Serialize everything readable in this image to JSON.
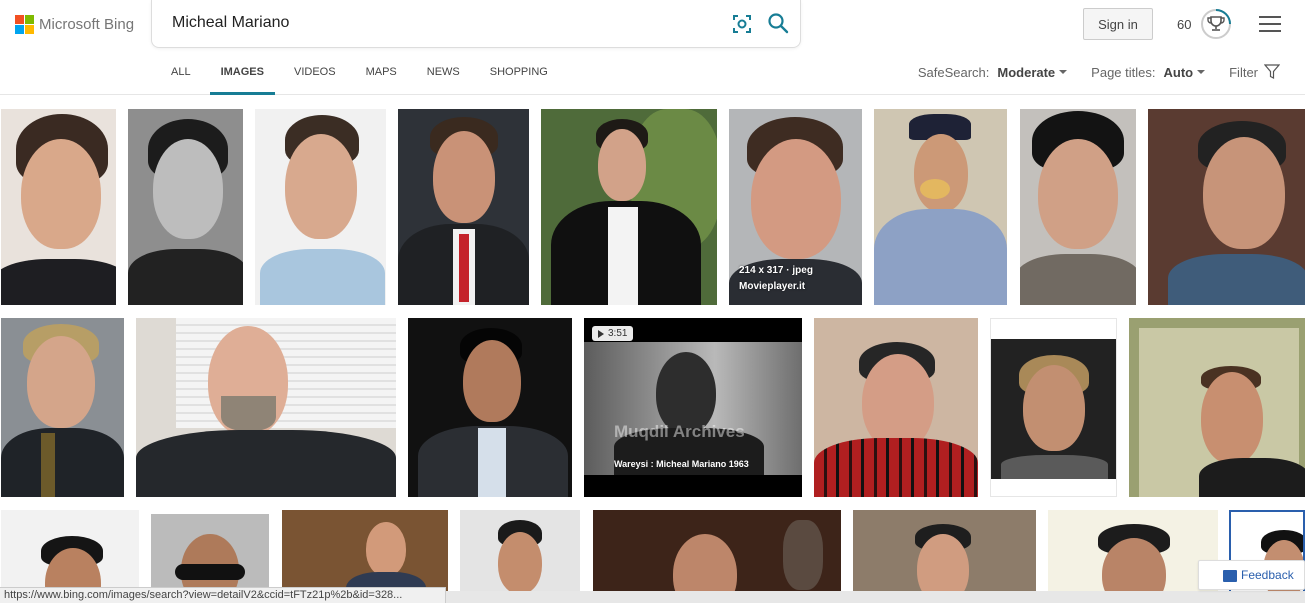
{
  "brand": {
    "name": "Microsoft Bing",
    "logo_colors": [
      "#f25022",
      "#7fba00",
      "#00a4ef",
      "#ffb900"
    ]
  },
  "search": {
    "query": "Micheal Mariano"
  },
  "account": {
    "signin_label": "Sign in",
    "rewards_points": "60"
  },
  "tabs": [
    {
      "label": "ALL",
      "active": false
    },
    {
      "label": "IMAGES",
      "active": true
    },
    {
      "label": "VIDEOS",
      "active": false
    },
    {
      "label": "MAPS",
      "active": false
    },
    {
      "label": "NEWS",
      "active": false
    },
    {
      "label": "SHOPPING",
      "active": false
    }
  ],
  "filters": {
    "safesearch_label": "SafeSearch:",
    "safesearch_value": "Moderate",
    "page_titles_label": "Page titles:",
    "page_titles_value": "Auto",
    "filter_label": "Filter"
  },
  "hover_overlay": {
    "dimensions": "214 x 317 · jpeg",
    "source": "Movieplayer.it"
  },
  "video_result": {
    "duration": "3:51",
    "watermark": "Muqdil Archives",
    "caption": "Wareysi : Micheal Mariano 1963"
  },
  "status_bar": {
    "url": "https://www.bing.com/images/search?view=detailV2&ccid=tFTz21p%2b&id=328..."
  },
  "feedback": {
    "label": "Feedback"
  },
  "colors": {
    "accent": "#177d95",
    "link_blue": "#2a5fad"
  }
}
